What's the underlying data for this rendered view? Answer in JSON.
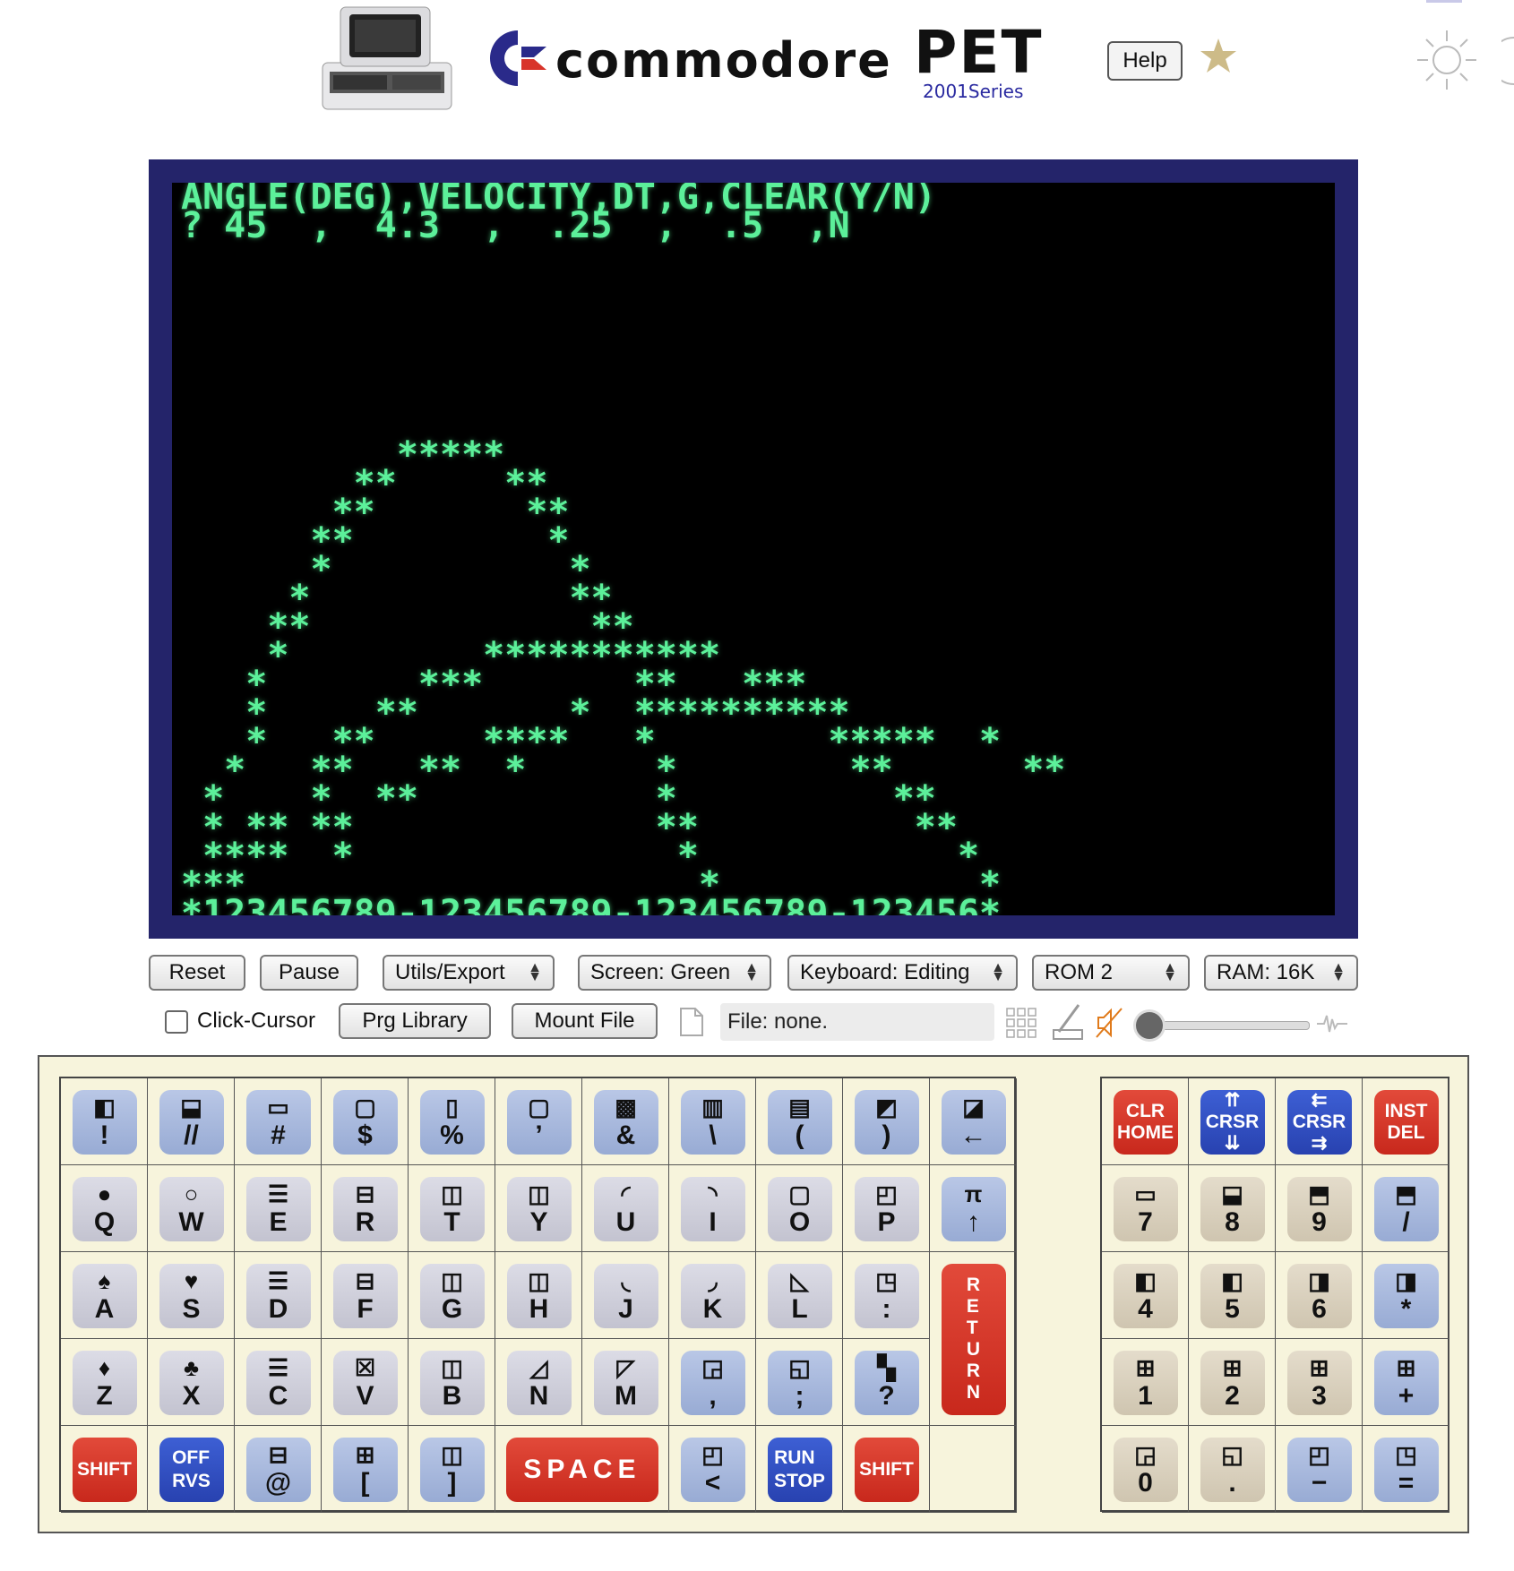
{
  "header": {
    "brand_word": "commodore",
    "brand_model": "PET",
    "brand_series": "2001Series",
    "help_label": "Help",
    "icons": [
      "pet-computer-image",
      "commodore-logo-icon",
      "star-icon",
      "sun-icon",
      "moon-icon"
    ]
  },
  "screen": {
    "color": "#5cf09a",
    "lines": [
      "ANGLE(DEG),VELOCITY,DT,G,CLEAR(Y/N)",
      "? 45  ,  4.3  ,  .25  ,  .5  ,N",
      "",
      "",
      "",
      "",
      "",
      "",
      "",
      "          *****",
      "        **     **",
      "       **       **",
      "      **         *",
      "      *           *",
      "     *            **",
      "    **             **",
      "    *         ***********",
      "   *       ***       **   ***",
      "   *     **       *  **********",
      "   *   **     ****   *        *****  *",
      "  *   **   **  *      *        **      **",
      " *    *  **           *          **",
      " * ** **              **          **",
      " ****  *               *            *",
      "***                     *            *",
      "*123456789-123456789-123456789-123456*"
    ]
  },
  "controls": {
    "reset": "Reset",
    "pause": "Pause",
    "utils": "Utils/Export",
    "screen_mode": "Screen: Green",
    "keyboard_mode": "Keyboard: Editing",
    "rom": "ROM 2",
    "ram": "RAM: 16K",
    "click_cursor": "Click-Cursor",
    "prg_library": "Prg Library",
    "mount_file": "Mount File",
    "file_status": "File: none."
  },
  "keyboard": {
    "main_rows": [
      [
        {
          "l": "!",
          "s": "◧",
          "c": "blue"
        },
        {
          "l": "//",
          "s": "⬓",
          "c": "blue"
        },
        {
          "l": "#",
          "s": "▭",
          "c": "blue"
        },
        {
          "l": "$",
          "s": "▢",
          "c": "blue"
        },
        {
          "l": "%",
          "s": "▯",
          "c": "blue"
        },
        {
          "l": "’",
          "s": "▢",
          "c": "blue"
        },
        {
          "l": "&",
          "s": "▩",
          "c": "blue"
        },
        {
          "l": "\\",
          "s": "▥",
          "c": "blue"
        },
        {
          "l": "(",
          "s": "▤",
          "c": "blue"
        },
        {
          "l": ")",
          "s": "◩",
          "c": "blue"
        },
        {
          "l": "←",
          "s": "◪",
          "c": "blue"
        }
      ],
      [
        {
          "l": "Q",
          "s": "●",
          "c": "gray"
        },
        {
          "l": "W",
          "s": "○",
          "c": "gray"
        },
        {
          "l": "E",
          "s": "☰",
          "c": "gray"
        },
        {
          "l": "R",
          "s": "⊟",
          "c": "gray"
        },
        {
          "l": "T",
          "s": "◫",
          "c": "gray"
        },
        {
          "l": "Y",
          "s": "◫",
          "c": "gray"
        },
        {
          "l": "U",
          "s": "◜",
          "c": "gray"
        },
        {
          "l": "I",
          "s": "◝",
          "c": "gray"
        },
        {
          "l": "O",
          "s": "▢",
          "c": "gray"
        },
        {
          "l": "P",
          "s": "◰",
          "c": "gray"
        },
        {
          "l": "↑",
          "s": "π",
          "c": "blue"
        }
      ],
      [
        {
          "l": "A",
          "s": "♠",
          "c": "gray"
        },
        {
          "l": "S",
          "s": "♥",
          "c": "gray"
        },
        {
          "l": "D",
          "s": "☰",
          "c": "gray"
        },
        {
          "l": "F",
          "s": "⊟",
          "c": "gray"
        },
        {
          "l": "G",
          "s": "◫",
          "c": "gray"
        },
        {
          "l": "H",
          "s": "◫",
          "c": "gray"
        },
        {
          "l": "J",
          "s": "◟",
          "c": "gray"
        },
        {
          "l": "K",
          "s": "◞",
          "c": "gray"
        },
        {
          "l": "L",
          "s": "◺",
          "c": "gray"
        },
        {
          "l": ":",
          "s": "◳",
          "c": "gray"
        }
      ],
      [
        {
          "l": "Z",
          "s": "♦",
          "c": "gray"
        },
        {
          "l": "X",
          "s": "♣",
          "c": "gray"
        },
        {
          "l": "C",
          "s": "☰",
          "c": "gray"
        },
        {
          "l": "V",
          "s": "☒",
          "c": "gray"
        },
        {
          "l": "B",
          "s": "◫",
          "c": "gray"
        },
        {
          "l": "N",
          "s": "◿",
          "c": "gray"
        },
        {
          "l": "M",
          "s": "◸",
          "c": "gray"
        },
        {
          "l": ",",
          "s": "◲",
          "c": "blue"
        },
        {
          "l": ";",
          "s": "◱",
          "c": "blue"
        },
        {
          "l": "?",
          "s": "▚",
          "c": "blue"
        }
      ],
      [
        {
          "l": "@",
          "s": "⊟",
          "c": "blue"
        },
        {
          "l": "[",
          "s": "⊞",
          "c": "blue"
        },
        {
          "l": "]",
          "s": "◫",
          "c": "blue"
        },
        {
          "l": "<",
          "s": "◰",
          "c": "blue"
        },
        {
          "l": ">",
          "s": "◳",
          "c": "blue"
        }
      ]
    ],
    "special": {
      "return": "RETURN",
      "shift_left": "SHIFT",
      "shift_right": "SHIFT",
      "off_rvs": [
        "OFF",
        "RVS"
      ],
      "space": "SPACE",
      "run_stop": [
        "RUN",
        "STOP"
      ]
    },
    "num_rows": [
      [
        {
          "l": "CLR\nHOME",
          "c": "red"
        },
        {
          "l": "⇈\nCRSR\n⇊",
          "c": "dblue"
        },
        {
          "l": "⇇\nCRSR\n⇉",
          "c": "dblue"
        },
        {
          "l": "INST\nDEL",
          "c": "red"
        }
      ],
      [
        {
          "l": "7",
          "s": "▭",
          "c": "tan"
        },
        {
          "l": "8",
          "s": "⬓",
          "c": "tan"
        },
        {
          "l": "9",
          "s": "⬒",
          "c": "tan"
        },
        {
          "l": "/",
          "s": "⬒",
          "c": "blue"
        }
      ],
      [
        {
          "l": "4",
          "s": "◧",
          "c": "tan"
        },
        {
          "l": "5",
          "s": "◧",
          "c": "tan"
        },
        {
          "l": "6",
          "s": "◨",
          "c": "tan"
        },
        {
          "l": "*",
          "s": "◨",
          "c": "blue"
        }
      ],
      [
        {
          "l": "1",
          "s": "⊞",
          "c": "tan"
        },
        {
          "l": "2",
          "s": "⊞",
          "c": "tan"
        },
        {
          "l": "3",
          "s": "⊞",
          "c": "tan"
        },
        {
          "l": "+",
          "s": "⊞",
          "c": "blue"
        }
      ],
      [
        {
          "l": "0",
          "s": "◲",
          "c": "tan"
        },
        {
          "l": ".",
          "s": "◱",
          "c": "tan"
        },
        {
          "l": "−",
          "s": "◰",
          "c": "blue"
        },
        {
          "l": "=",
          "s": "◳",
          "c": "blue"
        }
      ]
    ]
  }
}
